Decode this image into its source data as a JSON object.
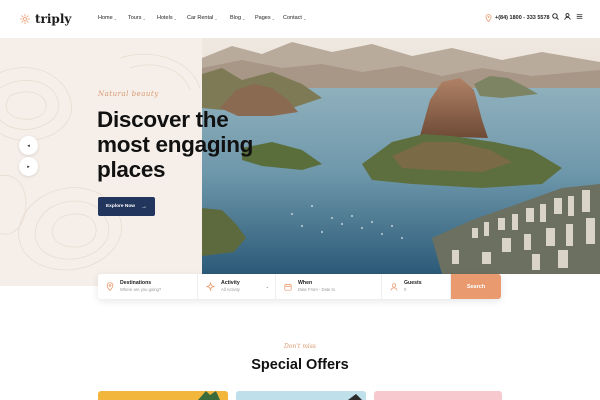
{
  "header": {
    "logo_text": "triply",
    "nav": [
      "Home",
      "Tours",
      "Hotels",
      "Car Rental",
      "Blog",
      "Pages",
      "Contact"
    ],
    "phone": "+(84) 1800 - 333 5578"
  },
  "hero": {
    "tagline": "Natural beauty",
    "title_lines": [
      "Discover the",
      "most engaging",
      "places"
    ],
    "cta": "Explore Now"
  },
  "search": {
    "destinations_label": "Destinations",
    "destinations_placeholder": "Where are you going?",
    "activity_label": "Activity",
    "activity_value": "All Activity",
    "when_label": "When",
    "when_value": "Date From - Date to",
    "guests_label": "Guests",
    "guests_value": "0",
    "button": "Search"
  },
  "offers": {
    "tagline": "Don't miss",
    "title": "Special Offers"
  },
  "colors": {
    "accent": "#e99a6e",
    "navy": "#22355c",
    "cream": "#f6efe9",
    "script": "#d79a72"
  }
}
